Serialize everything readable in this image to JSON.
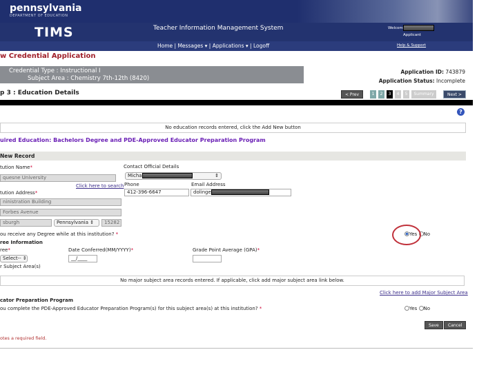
{
  "header": {
    "logo_title": "pennsylvania",
    "logo_subtitle": "DEPARTMENT OF EDUCATION",
    "app_name": "TIMS",
    "system_name": "Teacher Information Management System",
    "welcome": "Welcom",
    "role": "Applicant",
    "help_link": "Help & Support",
    "nav": [
      "Home",
      "Messages",
      "Applications",
      "Logoff"
    ]
  },
  "page": {
    "title": "w Credential Application",
    "credential_type": "Credential Type : Instructional I",
    "subject_area": "Subject Area : Chemistry 7th-12th (8420)",
    "app_id_label": "Application ID:",
    "app_id": "743879",
    "status_label": "Application Status:",
    "status": "Incomplete",
    "step_title": "p 3 : Education Details",
    "prev": "< Prev",
    "steps": [
      "1",
      "2",
      "3",
      "4",
      "5"
    ],
    "summary": "Summary",
    "next": "Next >",
    "current_step": 3
  },
  "records": {
    "empty_msg": "No education records entered, click the Add New button"
  },
  "required_heading": "uired Education: Bachelors Degree and PDE-Approved Educator Preparation Program",
  "form": {
    "band": "New Record",
    "inst_name_label": "tution Name",
    "inst_name": "quesne University",
    "search_link": "Click here to search",
    "inst_addr_label": "tution Address",
    "addr1": "ninistration Building",
    "addr2": "Forbes Avenue",
    "city": "sburgh",
    "state": "Pennsylvania",
    "zip": "15282",
    "contact_label": "Contact Official Details",
    "contact": "Micha",
    "phone_label": "Phone",
    "phone": "412-396-6647",
    "email_label": "Email Address",
    "email": "dolinge",
    "degree_q": "ou receive any Degree while at this institution?",
    "degree_answer": "Yes",
    "yes": "Yes",
    "no": "No",
    "deg_info": "ree Information",
    "degree_label": "ree",
    "degree_select": "Select--",
    "date_label": "Date Conferred(MM/YYYY)",
    "date_value": "__/____",
    "gpa_label": "Grade Point Average (GPA)",
    "major_label": "r Subject Area(s)",
    "major_empty": "No major subject area records entered. If applicable, click add major subject area link below.",
    "add_major": "Click here to add Major Subject Area",
    "prep_heading": "cator Preparation Program",
    "prep_q": "ou complete the PDE-Approved Educator Preparation Program(s) for this subject area(s) at this institution?",
    "save": "Save",
    "cancel": "Cancel",
    "required_note": "otes a required field.",
    "asterisk": "*"
  },
  "colors": {
    "header": "#1f2f6e",
    "title_red": "#a0202a",
    "purple": "#6a1fb5",
    "annotation_circle": "#c0303a"
  }
}
